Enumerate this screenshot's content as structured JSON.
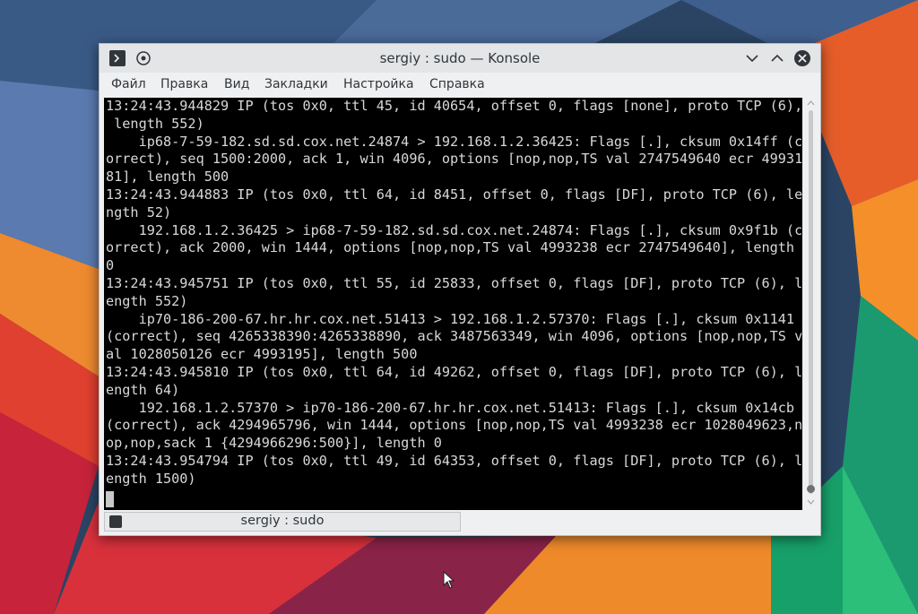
{
  "window": {
    "title": "sergiy : sudo — Konsole",
    "icons": {
      "app": "terminal-icon",
      "pin": "pin-icon",
      "minimize": "chevron-down-icon",
      "maximize": "chevron-up-icon",
      "close": "close-icon"
    }
  },
  "menu": {
    "items": [
      "Файл",
      "Правка",
      "Вид",
      "Закладки",
      "Настройка",
      "Справка"
    ]
  },
  "terminal": {
    "lines": [
      "13:24:43.944829 IP (tos 0x0, ttl 45, id 40654, offset 0, flags [none], proto TCP (6),",
      " length 552)",
      "    ip68-7-59-182.sd.sd.cox.net.24874 > 192.168.1.2.36425: Flags [.], cksum 0x14ff (c",
      "orrect), seq 1500:2000, ack 1, win 4096, options [nop,nop,TS val 2747549640 ecr 49931",
      "81], length 500",
      "13:24:43.944883 IP (tos 0x0, ttl 64, id 8451, offset 0, flags [DF], proto TCP (6), le",
      "ngth 52)",
      "    192.168.1.2.36425 > ip68-7-59-182.sd.sd.cox.net.24874: Flags [.], cksum 0x9f1b (c",
      "orrect), ack 2000, win 1444, options [nop,nop,TS val 4993238 ecr 2747549640], length",
      "0",
      "13:24:43.945751 IP (tos 0x0, ttl 55, id 25833, offset 0, flags [DF], proto TCP (6), l",
      "ength 552)",
      "    ip70-186-200-67.hr.hr.cox.net.51413 > 192.168.1.2.57370: Flags [.], cksum 0x1141",
      "(correct), seq 4265338390:4265338890, ack 3487563349, win 4096, options [nop,nop,TS v",
      "al 1028050126 ecr 4993195], length 500",
      "13:24:43.945810 IP (tos 0x0, ttl 64, id 49262, offset 0, flags [DF], proto TCP (6), l",
      "ength 64)",
      "    192.168.1.2.57370 > ip70-186-200-67.hr.hr.cox.net.51413: Flags [.], cksum 0x14cb",
      "(correct), ack 4294965796, win 1444, options [nop,nop,TS val 4993238 ecr 1028049623,n",
      "op,nop,sack 1 {4294966296:500}], length 0",
      "13:24:43.954794 IP (tos 0x0, ttl 49, id 64353, offset 0, flags [DF], proto TCP (6), l",
      "ength 1500)"
    ]
  },
  "tab": {
    "label": "sergiy : sudo"
  },
  "colors": {
    "accent_green": "#1fa06a",
    "accent_orange": "#ef7a1d",
    "accent_red": "#d4323a"
  }
}
